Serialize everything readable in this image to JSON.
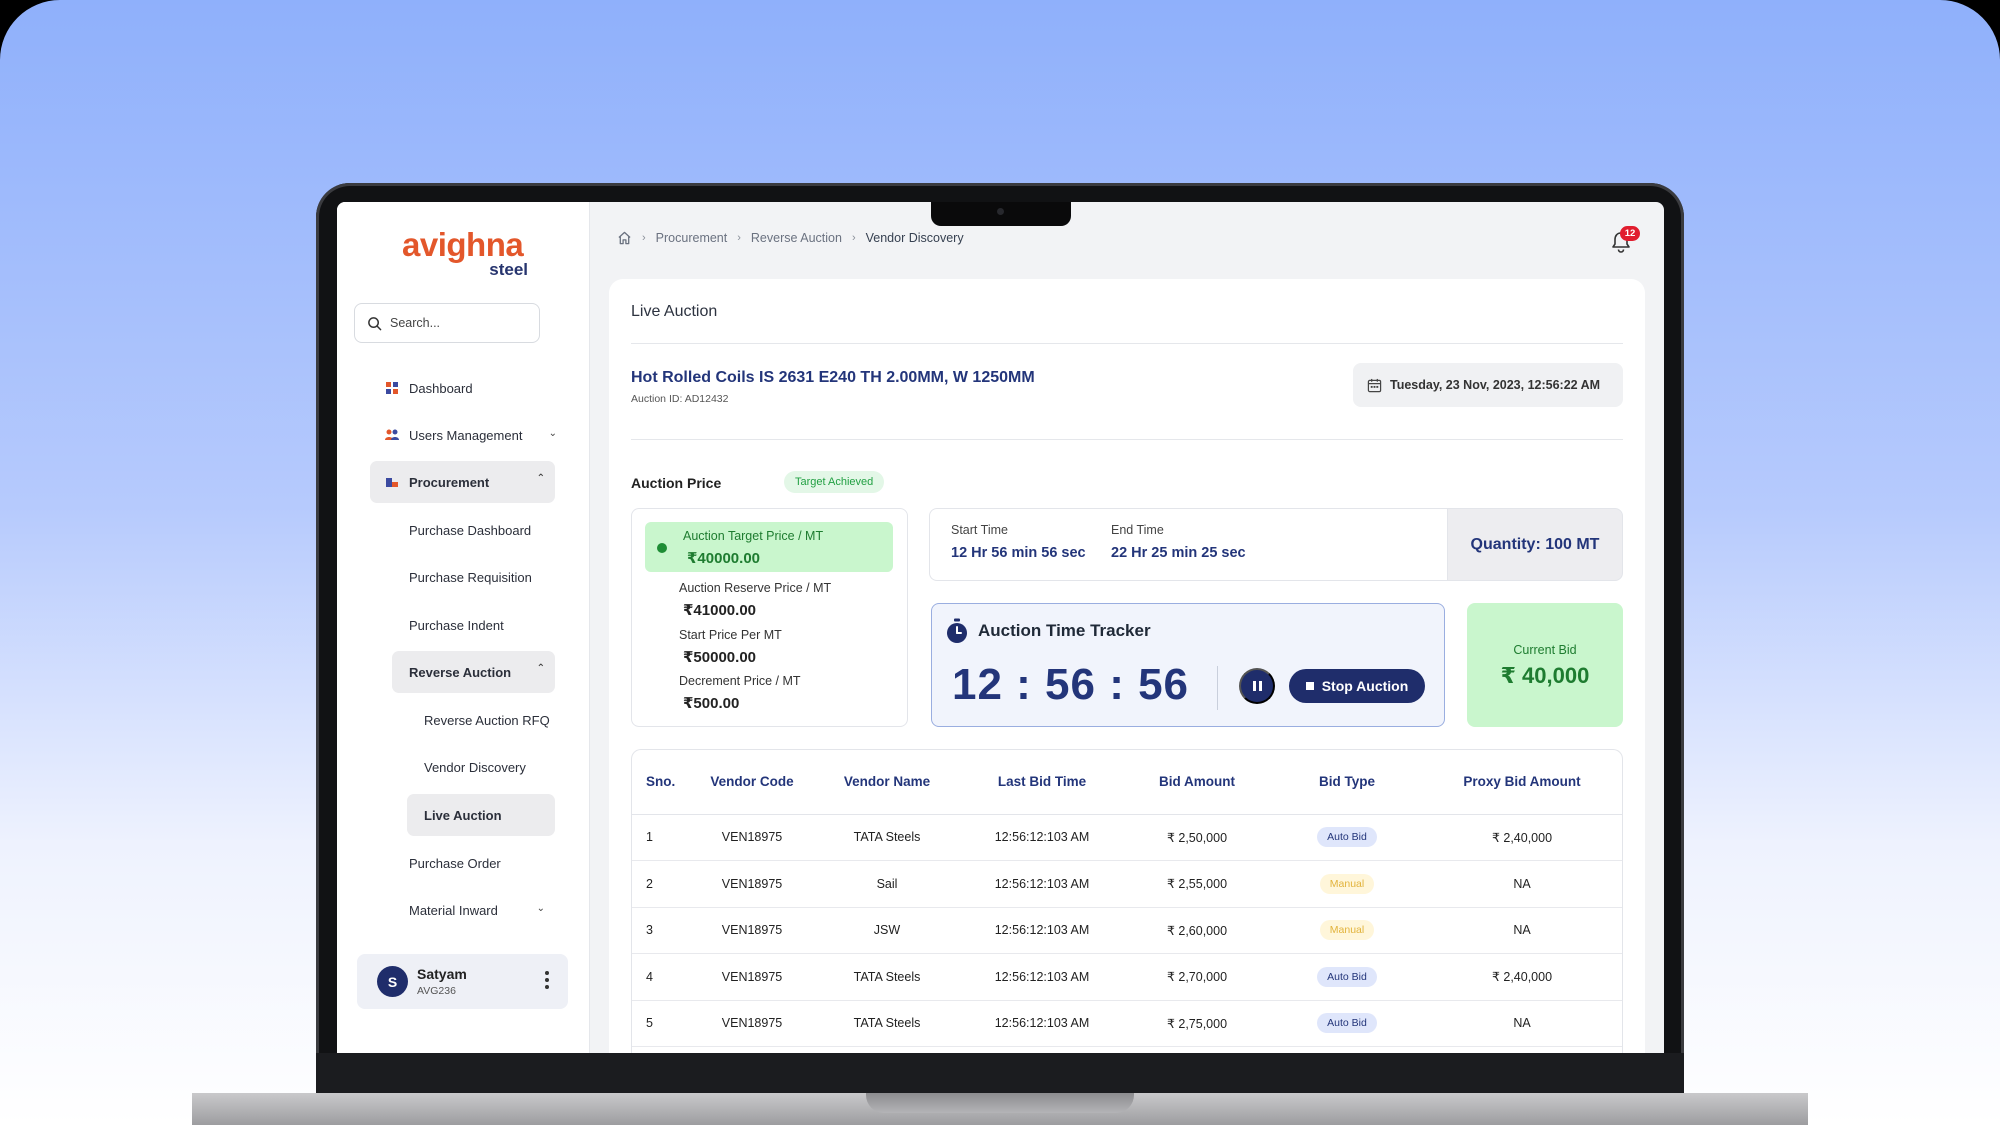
{
  "brand": {
    "logo_main": "avighna",
    "logo_sub": "steel"
  },
  "search": {
    "placeholder": "Search..."
  },
  "sidebar": {
    "items": [
      {
        "label": "Dashboard"
      },
      {
        "label": "Users Management"
      },
      {
        "label": "Procurement"
      },
      {
        "label": "Purchase Dashboard"
      },
      {
        "label": "Purchase Requisition"
      },
      {
        "label": "Purchase Indent"
      },
      {
        "label": "Reverse Auction"
      },
      {
        "label": "Reverse Auction RFQ"
      },
      {
        "label": "Vendor Discovery"
      },
      {
        "label": "Live Auction"
      },
      {
        "label": "Purchase Order"
      },
      {
        "label": "Material Inward"
      }
    ],
    "user": {
      "initial": "S",
      "name": "Satyam",
      "id": "AVG236"
    }
  },
  "breadcrumb": {
    "items": [
      "Procurement",
      "Reverse Auction",
      "Vendor Discovery"
    ]
  },
  "notifications": {
    "count": "12"
  },
  "page": {
    "title": "Live Auction",
    "product_title": "Hot Rolled Coils IS 2631 E240 TH 2.00MM, W 1250MM",
    "auction_id": "Auction ID: AD12432",
    "datetime": "Tuesday, 23 Nov, 2023, 12:56:22 AM"
  },
  "auction_price": {
    "label": "Auction Price",
    "badge": "Target Achieved",
    "target_label": "Auction Target Price / MT",
    "target_value": "₹40000.00",
    "reserve_label": "Auction Reserve Price / MT",
    "reserve_value": "₹41000.00",
    "start_label": "Start Price Per MT",
    "start_value": "₹50000.00",
    "decrement_label": "Decrement Price / MT",
    "decrement_value": "₹500.00"
  },
  "timing": {
    "start_label": "Start Time",
    "start_value": "12 Hr 56 min 56 sec",
    "end_label": "End Time",
    "end_value": "22 Hr 25 min 25 sec",
    "quantity": "Quantity: 100 MT"
  },
  "tracker": {
    "title": "Auction Time Tracker",
    "clock": "12 : 56 : 56",
    "stop_label": "Stop Auction"
  },
  "current_bid": {
    "label": "Current Bid",
    "value": "₹ 40,000"
  },
  "bids_table": {
    "headers": [
      "Sno.",
      "Vendor Code",
      "Vendor Name",
      "Last Bid Time",
      "Bid Amount",
      "Bid Type",
      "Proxy Bid Amount"
    ],
    "rows": [
      {
        "sno": "1",
        "code": "VEN18975",
        "name": "TATA Steels",
        "time": "12:56:12:103 AM",
        "amount": "₹ 2,50,000",
        "type": "Auto Bid",
        "proxy": "₹ 2,40,000"
      },
      {
        "sno": "2",
        "code": "VEN18975",
        "name": "Sail",
        "time": "12:56:12:103 AM",
        "amount": "₹ 2,55,000",
        "type": "Manual",
        "proxy": "NA"
      },
      {
        "sno": "3",
        "code": "VEN18975",
        "name": "JSW",
        "time": "12:56:12:103 AM",
        "amount": "₹ 2,60,000",
        "type": "Manual",
        "proxy": "NA"
      },
      {
        "sno": "4",
        "code": "VEN18975",
        "name": "TATA Steels",
        "time": "12:56:12:103 AM",
        "amount": "₹ 2,70,000",
        "type": "Auto Bid",
        "proxy": "₹ 2,40,000"
      },
      {
        "sno": "5",
        "code": "VEN18975",
        "name": "TATA Steels",
        "time": "12:56:12:103 AM",
        "amount": "₹ 2,75,000",
        "type": "Auto Bid",
        "proxy": "NA"
      }
    ]
  },
  "colors": {
    "brand_orange": "#e3572b",
    "navy": "#23357a",
    "button_navy": "#1f2d6b",
    "success_green": "#1e7c30",
    "success_bg": "#c9f6cd",
    "alert_red": "#e11d2e"
  }
}
